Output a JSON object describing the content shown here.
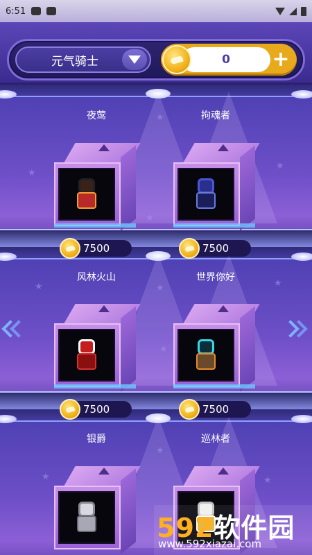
{
  "status_bar": {
    "time": "6:51"
  },
  "header": {
    "game_selector": {
      "selected": "元气骑士"
    },
    "coin_balance": "0",
    "add_coins_label": "+"
  },
  "shelves": [
    {
      "items": [
        {
          "name": "夜莺",
          "price": "7500"
        },
        {
          "name": "拘魂者",
          "price": "7500"
        }
      ]
    },
    {
      "items": [
        {
          "name": "风林火山",
          "price": "7500"
        },
        {
          "name": "世界你好",
          "price": "7500"
        }
      ]
    },
    {
      "items": [
        {
          "name": "银爵",
          "price": ""
        },
        {
          "name": "巡林者",
          "price": ""
        }
      ]
    }
  ],
  "watermark": {
    "brand_digits": "592",
    "brand_text": "软件园",
    "url": "www.592xiazai.com"
  },
  "colors": {
    "accent_gold": "#e8a91c",
    "panel_purple": "#3b2b8f",
    "arrow_blue": "#7fb2ff"
  },
  "icons": {
    "dropdown": "triangle-down-icon",
    "coin": "coin-icon",
    "add": "plus-icon",
    "prev": "double-chevron-left-icon",
    "next": "double-chevron-right-icon"
  }
}
